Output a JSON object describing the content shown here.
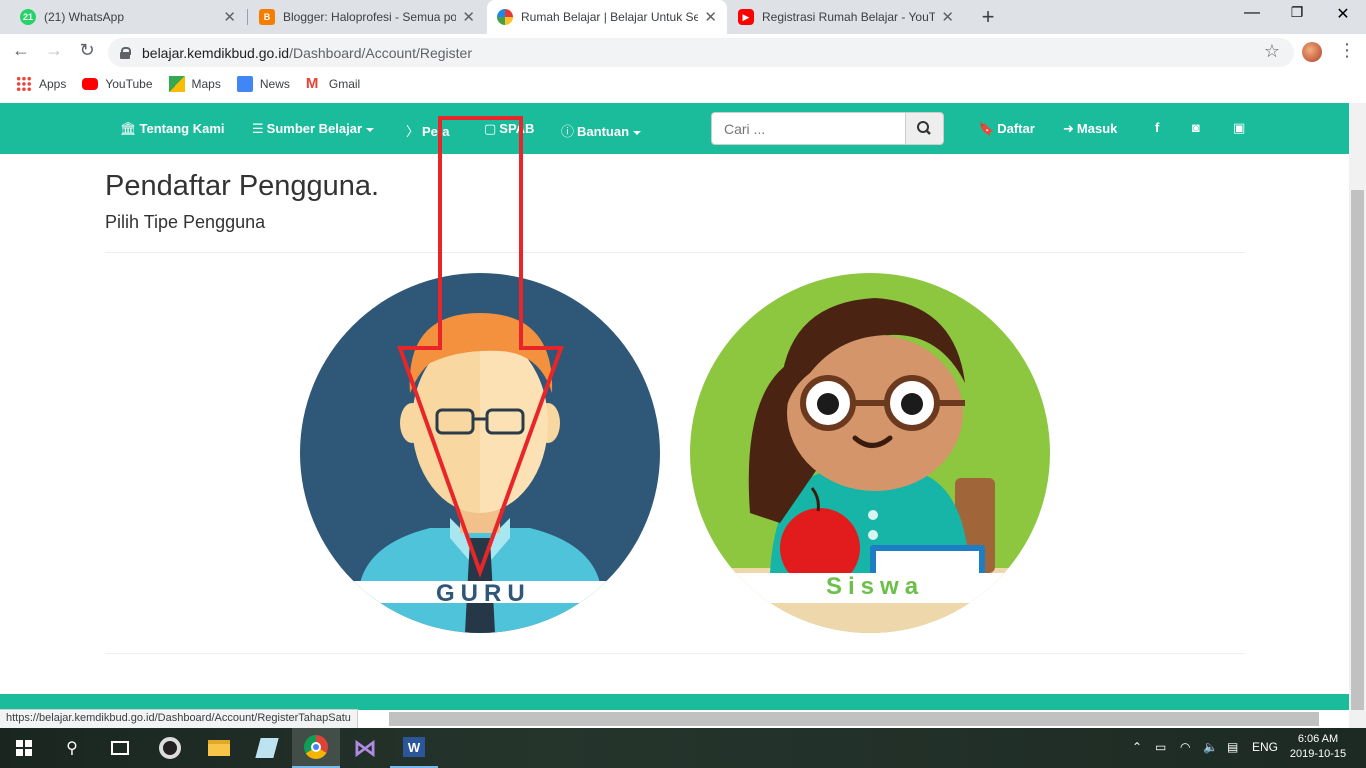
{
  "browser": {
    "tabs": [
      {
        "title": "(21) WhatsApp",
        "badge": "21"
      },
      {
        "title": "Blogger: Haloprofesi - Semua po"
      },
      {
        "title": "Rumah Belajar | Belajar Untuk Se"
      },
      {
        "title": "Registrasi Rumah Belajar - YouTu"
      }
    ],
    "url_host": "belajar.kemdikbud.go.id",
    "url_path": "/Dashboard/Account/Register",
    "bookmarks": [
      "Apps",
      "YouTube",
      "Maps",
      "News",
      "Gmail"
    ],
    "status_url": "https://belajar.kemdikbud.go.id/Dashboard/Account/RegisterTahapSatu"
  },
  "site_nav": {
    "items": [
      "Tentang Kami",
      "Sumber Belajar",
      "Peta",
      "SPAB",
      "Bantuan"
    ],
    "search_placeholder": "Cari ...",
    "daftar": "Daftar",
    "masuk": "Masuk",
    "accent": "#1abc9c"
  },
  "page": {
    "title": "Pendaftar Pengguna.",
    "subtitle": "Pilih Tipe Pengguna",
    "cards": [
      {
        "label": "GURU"
      },
      {
        "label": "Siswa"
      }
    ]
  },
  "taskbar": {
    "lang": "ENG",
    "time": "6:06 AM",
    "date": "2019-10-15"
  }
}
